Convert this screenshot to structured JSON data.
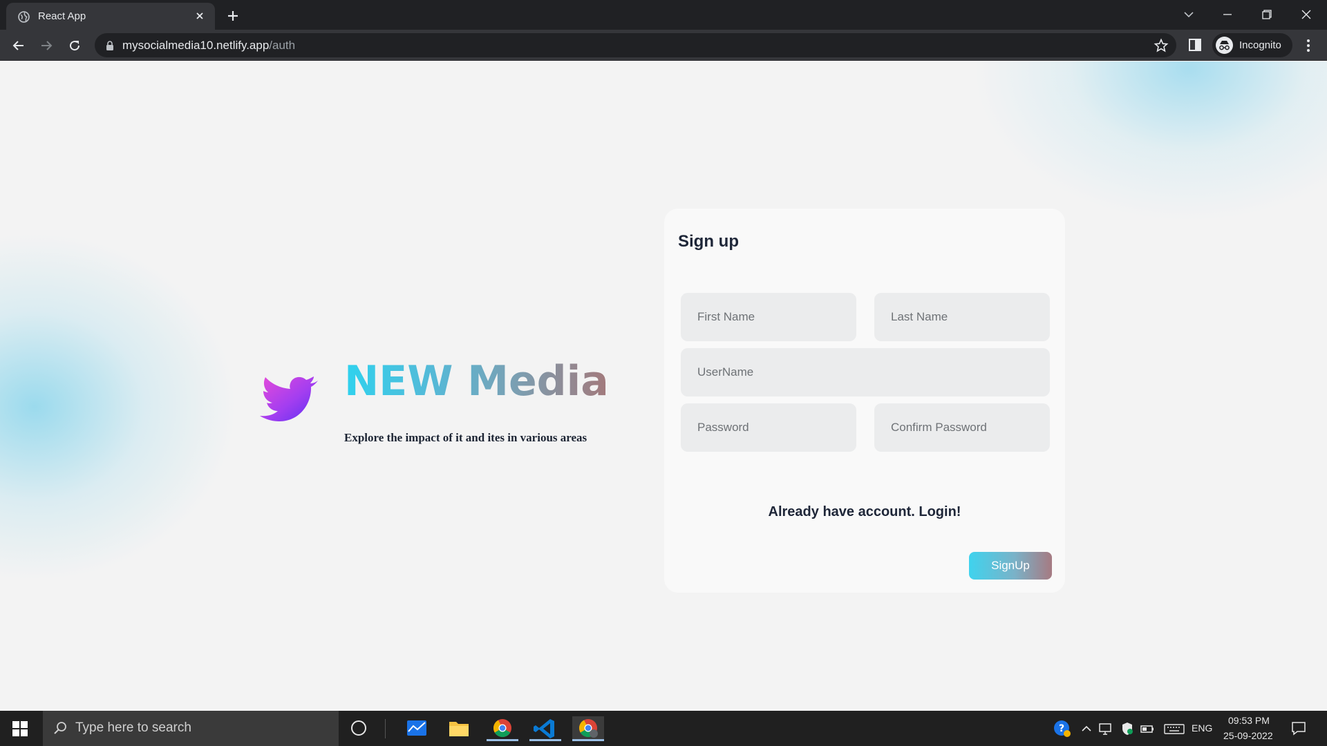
{
  "browser": {
    "tab_title": "React App",
    "url_host": "mysocialmedia10.netlify.app",
    "url_path": "/auth",
    "profile_label": "Incognito"
  },
  "brand": {
    "name": "NEW Media",
    "tagline": "Explore the impact of it and ites in various areas",
    "logo_icon": "bird-icon",
    "gradient_colors": [
      "#2fd2ee",
      "#a3797b"
    ]
  },
  "signup_form": {
    "title": "Sign up",
    "first_name_placeholder": "First Name",
    "last_name_placeholder": "Last Name",
    "username_placeholder": "UserName",
    "password_placeholder": "Password",
    "confirm_password_placeholder": "Confirm Password",
    "login_link": "Already have account. Login!",
    "submit_label": "SignUp"
  },
  "taskbar": {
    "search_placeholder": "Type here to search",
    "language": "ENG",
    "time": "09:53 PM",
    "date": "25-09-2022",
    "pinned_apps": [
      "file-mail-icon",
      "file-explorer-icon",
      "chrome-icon",
      "vscode-icon",
      "chrome-incognito-icon"
    ]
  }
}
